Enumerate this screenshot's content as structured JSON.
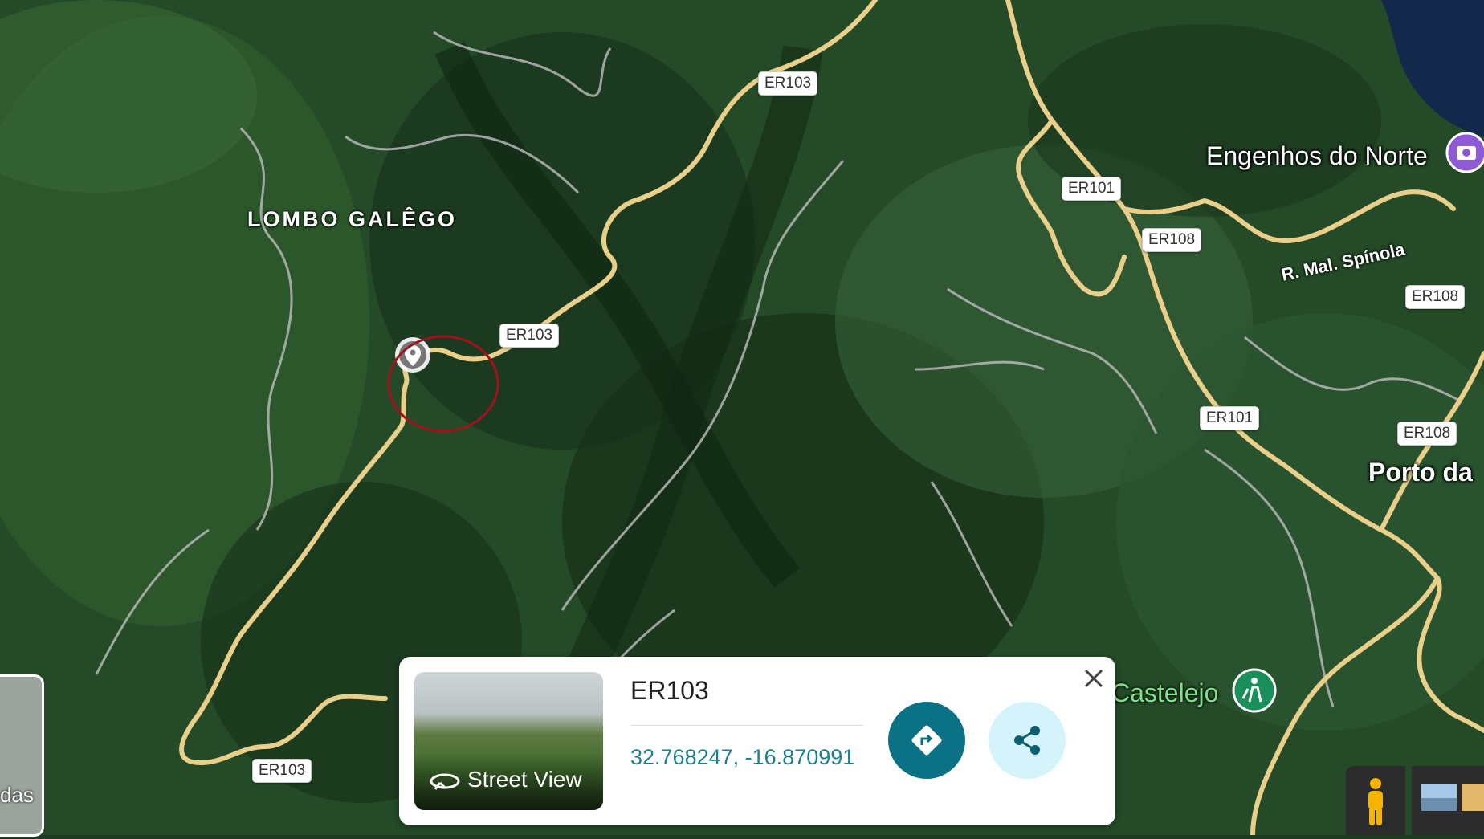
{
  "map": {
    "area_label": "LOMBO GALÊGO",
    "place_labels": {
      "engenhos": "Engenhos do Norte",
      "porto": "Porto da",
      "castelejo": "Castelejo",
      "left_edge": "das"
    },
    "street_label": "R. Mal. Spínola",
    "road_shields": [
      "ER103",
      "ER103",
      "ER103",
      "ER101",
      "ER101",
      "ER108",
      "ER108",
      "ER108"
    ]
  },
  "card": {
    "title": "ER103",
    "coordinates": "32.768247, -16.870991",
    "street_view_label": "Street View",
    "icons": {
      "directions": "directions-icon",
      "share": "share-icon",
      "close": "close-icon",
      "street_view": "street-view-icon"
    }
  },
  "colors": {
    "road_major": "#e9cf8a",
    "road_minor": "#b7b7b7",
    "directions_button": "#0b7285",
    "share_button": "#d5f3fa",
    "coordinate_text": "#1a7f8e",
    "highlight_circle": "#a3111d"
  }
}
